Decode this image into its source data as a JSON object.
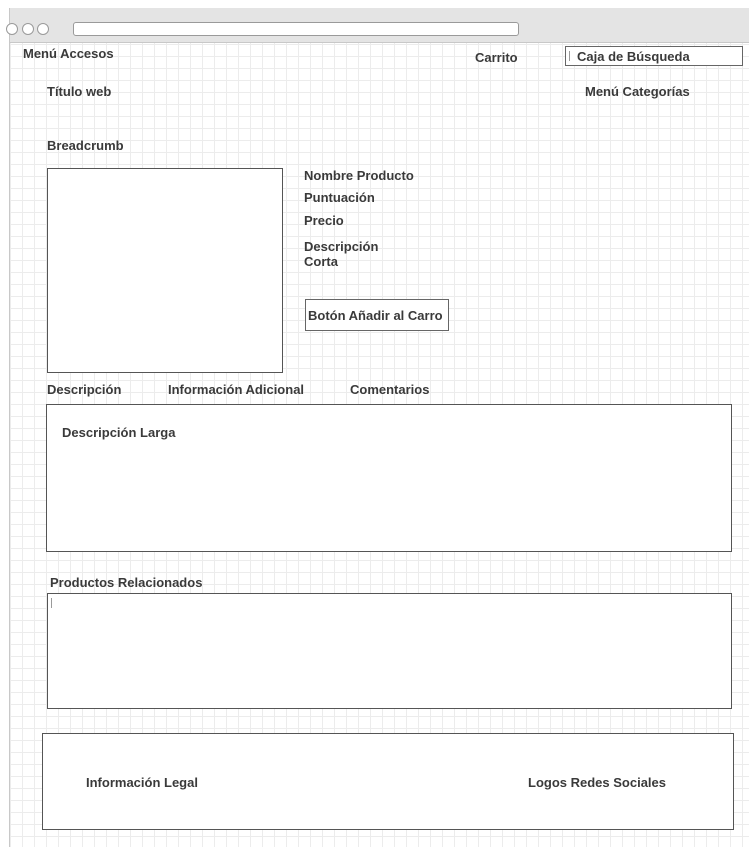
{
  "header": {
    "access_menu": "Menú Accesos",
    "cart": "Carrito",
    "search_placeholder": "Caja de Búsqueda",
    "site_title": "Título web",
    "categories_menu": "Menú Categorías"
  },
  "breadcrumb": "Breadcrumb",
  "product": {
    "name": "Nombre Producto",
    "rating": "Puntuación",
    "price": "Precio",
    "short_description_line1": "Descripción",
    "short_description_line2": "Corta",
    "add_to_cart_label": "Botón Añadir al Carro"
  },
  "tabs": [
    {
      "label": "Descripción"
    },
    {
      "label": "Información Adicional"
    },
    {
      "label": "Comentarios"
    }
  ],
  "long_description": "Descripción Larga",
  "related_products": "Productos Relacionados",
  "footer": {
    "legal": "Información Legal",
    "social": "Logos Redes Sociales"
  }
}
